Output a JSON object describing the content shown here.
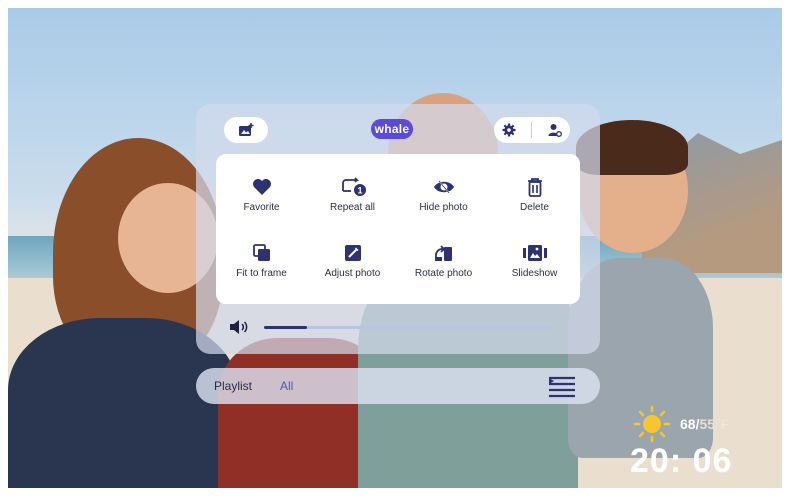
{
  "header": {
    "logo_text": "whale"
  },
  "menu": {
    "items": [
      {
        "label": "Favorite",
        "icon": "heart-icon"
      },
      {
        "label": "Repeat all",
        "icon": "repeat-icon"
      },
      {
        "label": "Hide photo",
        "icon": "eye-hide-icon"
      },
      {
        "label": "Delete",
        "icon": "trash-icon"
      },
      {
        "label": "Fit to frame",
        "icon": "fit-frame-icon"
      },
      {
        "label": "Adjust photo",
        "icon": "adjust-icon"
      },
      {
        "label": "Rotate photo",
        "icon": "rotate-icon"
      },
      {
        "label": "Slideshow",
        "icon": "slideshow-icon"
      }
    ]
  },
  "volume": {
    "level": 0.15
  },
  "playlist": {
    "title": "Playlist",
    "value": "All"
  },
  "weather": {
    "high": "68/",
    "low": "55°F",
    "time": "20: 06"
  },
  "colors": {
    "accent": "#2d3270",
    "logo": "#5b4bd6",
    "sun": "#f7c531"
  }
}
